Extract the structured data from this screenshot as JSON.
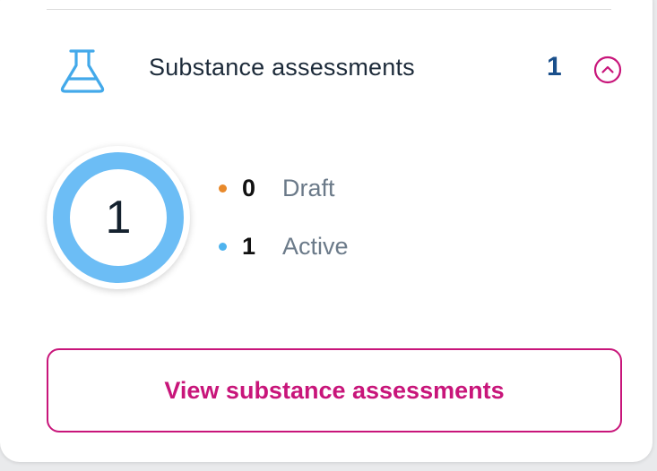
{
  "section": {
    "title": "Substance assessments",
    "count": "1",
    "icon": "flask-icon",
    "toggle_icon": "chevron-up-circle-icon",
    "expanded": true
  },
  "summary": {
    "total": "1",
    "items": [
      {
        "value": "0",
        "label": "Draft",
        "color": "#e8892b"
      },
      {
        "value": "1",
        "label": "Active",
        "color": "#4fb3ee"
      }
    ]
  },
  "actions": {
    "view_label": "View substance assessments"
  },
  "colors": {
    "accent": "#c8157a",
    "count": "#1a4f8b",
    "ring": "#6cbdf5",
    "icon": "#43a9ea"
  }
}
